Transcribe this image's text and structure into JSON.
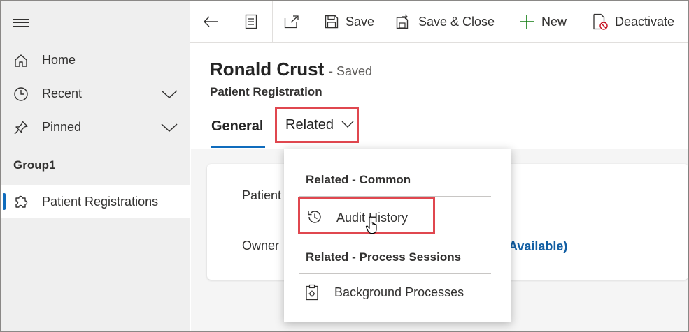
{
  "sidebar": {
    "items": [
      {
        "label": "Home",
        "icon": "home-icon"
      },
      {
        "label": "Recent",
        "icon": "clock-icon"
      },
      {
        "label": "Pinned",
        "icon": "pin-icon"
      }
    ],
    "group_label": "Group1",
    "active_item": {
      "label": "Patient Registrations",
      "icon": "puzzle-icon"
    }
  },
  "toolbar": {
    "save_label": "Save",
    "save_close_label": "Save & Close",
    "new_label": "New",
    "deactivate_label": "Deactivate"
  },
  "record": {
    "title": "Ronald Crust",
    "status": "- Saved",
    "entity": "Patient Registration"
  },
  "tabs": {
    "general": "General",
    "related": "Related"
  },
  "form": {
    "field1_label": "Patient",
    "field2_label": "Owner",
    "owner_value": "Available)"
  },
  "related_menu": {
    "section1": "Related - Common",
    "audit_history": "Audit History",
    "section2": "Related - Process Sessions",
    "background_processes": "Background Processes"
  },
  "colors": {
    "accent": "#0f6cbd",
    "highlight": "#e0474f",
    "new_icon": "#107c10"
  }
}
